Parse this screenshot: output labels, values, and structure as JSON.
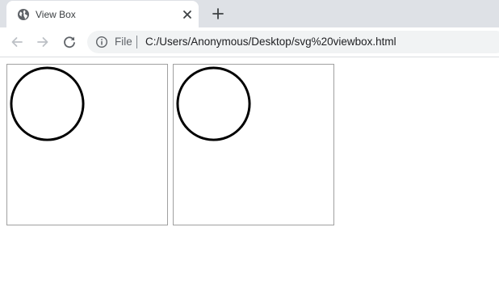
{
  "tab": {
    "title": "View Box",
    "icon": "globe-icon",
    "close_icon": "close-icon"
  },
  "toolbar": {
    "back_icon": "back-arrow-icon",
    "forward_icon": "forward-arrow-icon",
    "reload_icon": "reload-icon",
    "new_tab_icon": "plus-icon"
  },
  "omnibox": {
    "info_icon": "info-icon",
    "scheme": "File",
    "url": "C:/Users/Anonymous/Desktop/svg%20viewbox.html"
  },
  "page": {
    "boxes": [
      {
        "shape": "circle",
        "stroke": "#000000"
      },
      {
        "shape": "circle",
        "stroke": "#000000"
      }
    ]
  },
  "colors": {
    "tabstrip": "#dee1e6",
    "omnibox": "#f1f3f4",
    "border": "#a0a0a0"
  }
}
